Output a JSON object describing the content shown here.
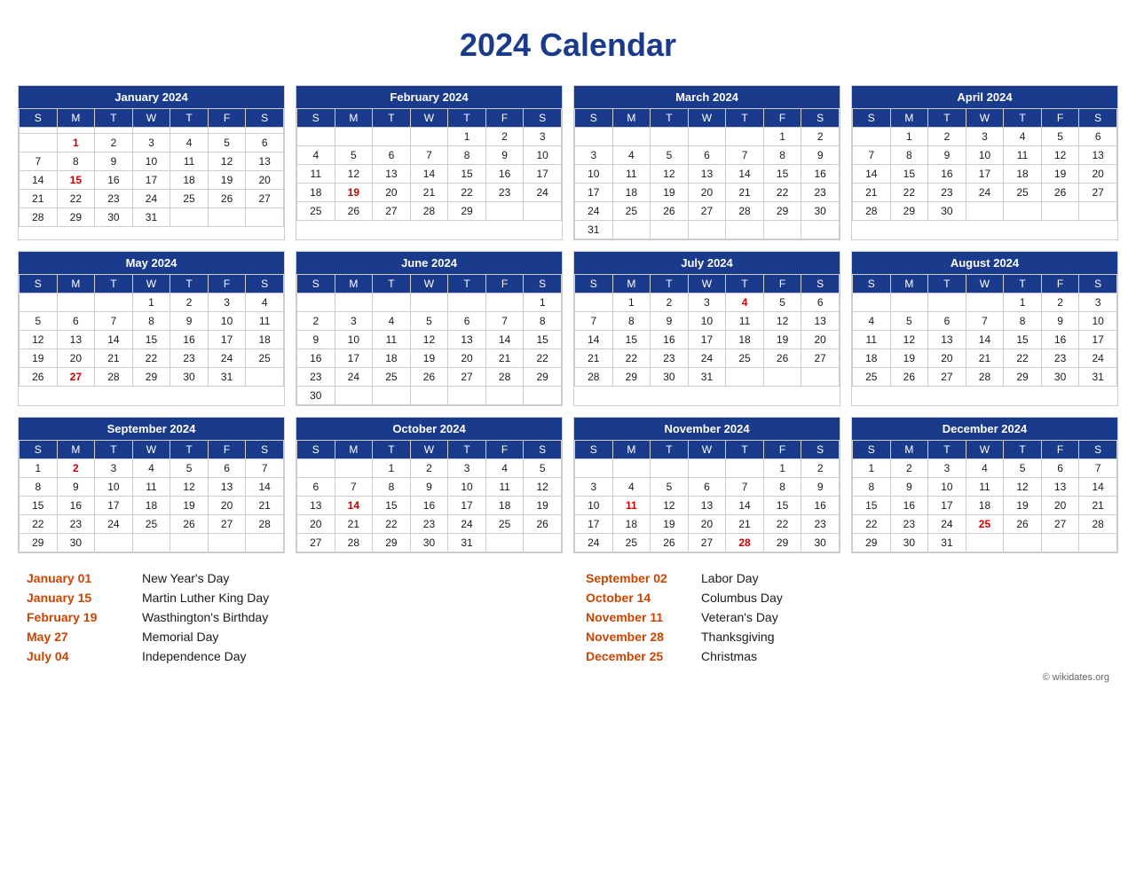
{
  "title": "2024 Calendar",
  "months": [
    {
      "name": "January 2024",
      "days": [
        [
          "",
          "",
          "",
          "",
          "",
          "",
          ""
        ],
        [
          "",
          "1",
          "2",
          "3",
          "4",
          "5",
          "6"
        ],
        [
          "7",
          "8",
          "9",
          "10",
          "11",
          "12",
          "13"
        ],
        [
          "14",
          "15",
          "16",
          "17",
          "18",
          "19",
          "20"
        ],
        [
          "21",
          "22",
          "23",
          "24",
          "25",
          "26",
          "27"
        ],
        [
          "28",
          "29",
          "30",
          "31",
          "",
          "",
          ""
        ]
      ],
      "holidays": [
        "1",
        "15"
      ]
    },
    {
      "name": "February 2024",
      "days": [
        [
          "",
          "",
          "",
          "",
          "1",
          "2",
          "3"
        ],
        [
          "4",
          "5",
          "6",
          "7",
          "8",
          "9",
          "10"
        ],
        [
          "11",
          "12",
          "13",
          "14",
          "15",
          "16",
          "17"
        ],
        [
          "18",
          "19",
          "20",
          "21",
          "22",
          "23",
          "24"
        ],
        [
          "25",
          "26",
          "27",
          "28",
          "29",
          "",
          ""
        ]
      ],
      "holidays": [
        "19"
      ]
    },
    {
      "name": "March 2024",
      "days": [
        [
          "",
          "",
          "",
          "",
          "",
          "1",
          "2"
        ],
        [
          "3",
          "4",
          "5",
          "6",
          "7",
          "8",
          "9"
        ],
        [
          "10",
          "11",
          "12",
          "13",
          "14",
          "15",
          "16"
        ],
        [
          "17",
          "18",
          "19",
          "20",
          "21",
          "22",
          "23"
        ],
        [
          "24",
          "25",
          "26",
          "27",
          "28",
          "29",
          "30"
        ],
        [
          "31",
          "",
          "",
          "",
          "",
          "",
          ""
        ]
      ],
      "holidays": []
    },
    {
      "name": "April 2024",
      "days": [
        [
          "",
          "1",
          "2",
          "3",
          "4",
          "5",
          "6"
        ],
        [
          "7",
          "8",
          "9",
          "10",
          "11",
          "12",
          "13"
        ],
        [
          "14",
          "15",
          "16",
          "17",
          "18",
          "19",
          "20"
        ],
        [
          "21",
          "22",
          "23",
          "24",
          "25",
          "26",
          "27"
        ],
        [
          "28",
          "29",
          "30",
          "",
          "",
          "",
          ""
        ]
      ],
      "holidays": []
    },
    {
      "name": "May 2024",
      "days": [
        [
          "",
          "",
          "",
          "1",
          "2",
          "3",
          "4"
        ],
        [
          "5",
          "6",
          "7",
          "8",
          "9",
          "10",
          "11"
        ],
        [
          "12",
          "13",
          "14",
          "15",
          "16",
          "17",
          "18"
        ],
        [
          "19",
          "20",
          "21",
          "22",
          "23",
          "24",
          "25"
        ],
        [
          "26",
          "27",
          "28",
          "29",
          "30",
          "31",
          ""
        ]
      ],
      "holidays": [
        "27"
      ]
    },
    {
      "name": "June 2024",
      "days": [
        [
          "",
          "",
          "",
          "",
          "",
          "",
          "1"
        ],
        [
          "2",
          "3",
          "4",
          "5",
          "6",
          "7",
          "8"
        ],
        [
          "9",
          "10",
          "11",
          "12",
          "13",
          "14",
          "15"
        ],
        [
          "16",
          "17",
          "18",
          "19",
          "20",
          "21",
          "22"
        ],
        [
          "23",
          "24",
          "25",
          "26",
          "27",
          "28",
          "29"
        ],
        [
          "30",
          "",
          "",
          "",
          "",
          "",
          ""
        ]
      ],
      "holidays": []
    },
    {
      "name": "July 2024",
      "days": [
        [
          "",
          "1",
          "2",
          "3",
          "4",
          "5",
          "6"
        ],
        [
          "7",
          "8",
          "9",
          "10",
          "11",
          "12",
          "13"
        ],
        [
          "14",
          "15",
          "16",
          "17",
          "18",
          "19",
          "20"
        ],
        [
          "21",
          "22",
          "23",
          "24",
          "25",
          "26",
          "27"
        ],
        [
          "28",
          "29",
          "30",
          "31",
          "",
          "",
          ""
        ]
      ],
      "holidays": [
        "4"
      ]
    },
    {
      "name": "August 2024",
      "days": [
        [
          "",
          "",
          "",
          "",
          "1",
          "2",
          "3"
        ],
        [
          "4",
          "5",
          "6",
          "7",
          "8",
          "9",
          "10"
        ],
        [
          "11",
          "12",
          "13",
          "14",
          "15",
          "16",
          "17"
        ],
        [
          "18",
          "19",
          "20",
          "21",
          "22",
          "23",
          "24"
        ],
        [
          "25",
          "26",
          "27",
          "28",
          "29",
          "30",
          "31"
        ]
      ],
      "holidays": []
    },
    {
      "name": "September 2024",
      "days": [
        [
          "1",
          "2",
          "3",
          "4",
          "5",
          "6",
          "7"
        ],
        [
          "8",
          "9",
          "10",
          "11",
          "12",
          "13",
          "14"
        ],
        [
          "15",
          "16",
          "17",
          "18",
          "19",
          "20",
          "21"
        ],
        [
          "22",
          "23",
          "24",
          "25",
          "26",
          "27",
          "28"
        ],
        [
          "29",
          "30",
          "",
          "",
          "",
          "",
          ""
        ]
      ],
      "holidays": [
        "2"
      ]
    },
    {
      "name": "October 2024",
      "days": [
        [
          "",
          "",
          "1",
          "2",
          "3",
          "4",
          "5"
        ],
        [
          "6",
          "7",
          "8",
          "9",
          "10",
          "11",
          "12"
        ],
        [
          "13",
          "14",
          "15",
          "16",
          "17",
          "18",
          "19"
        ],
        [
          "20",
          "21",
          "22",
          "23",
          "24",
          "25",
          "26"
        ],
        [
          "27",
          "28",
          "29",
          "30",
          "31",
          "",
          ""
        ]
      ],
      "holidays": [
        "14"
      ]
    },
    {
      "name": "November 2024",
      "days": [
        [
          "",
          "",
          "",
          "",
          "",
          "1",
          "2"
        ],
        [
          "3",
          "4",
          "5",
          "6",
          "7",
          "8",
          "9"
        ],
        [
          "10",
          "11",
          "12",
          "13",
          "14",
          "15",
          "16"
        ],
        [
          "17",
          "18",
          "19",
          "20",
          "21",
          "22",
          "23"
        ],
        [
          "24",
          "25",
          "26",
          "27",
          "28",
          "29",
          "30"
        ]
      ],
      "holidays": [
        "11",
        "28"
      ]
    },
    {
      "name": "December 2024",
      "days": [
        [
          "1",
          "2",
          "3",
          "4",
          "5",
          "6",
          "7"
        ],
        [
          "8",
          "9",
          "10",
          "11",
          "12",
          "13",
          "14"
        ],
        [
          "15",
          "16",
          "17",
          "18",
          "19",
          "20",
          "21"
        ],
        [
          "22",
          "23",
          "24",
          "25",
          "26",
          "27",
          "28"
        ],
        [
          "29",
          "30",
          "31",
          "",
          "",
          "",
          ""
        ]
      ],
      "holidays": [
        "25"
      ]
    }
  ],
  "holidays_list": [
    {
      "date": "January 01",
      "name": "New Year's Day"
    },
    {
      "date": "January 15",
      "name": "Martin Luther King Day"
    },
    {
      "date": "February 19",
      "name": "Wasthington's Birthday"
    },
    {
      "date": "May 27",
      "name": "Memorial Day"
    },
    {
      "date": "July 04",
      "name": "Independence Day"
    },
    {
      "date": "September 02",
      "name": "Labor Day"
    },
    {
      "date": "October 14",
      "name": "Columbus Day"
    },
    {
      "date": "November 11",
      "name": "Veteran's Day"
    },
    {
      "date": "November 28",
      "name": "Thanksgiving"
    },
    {
      "date": "December 25",
      "name": "Christmas"
    }
  ],
  "copyright": "© wikidates.org",
  "day_headers": [
    "S",
    "M",
    "T",
    "W",
    "T",
    "F",
    "S"
  ]
}
